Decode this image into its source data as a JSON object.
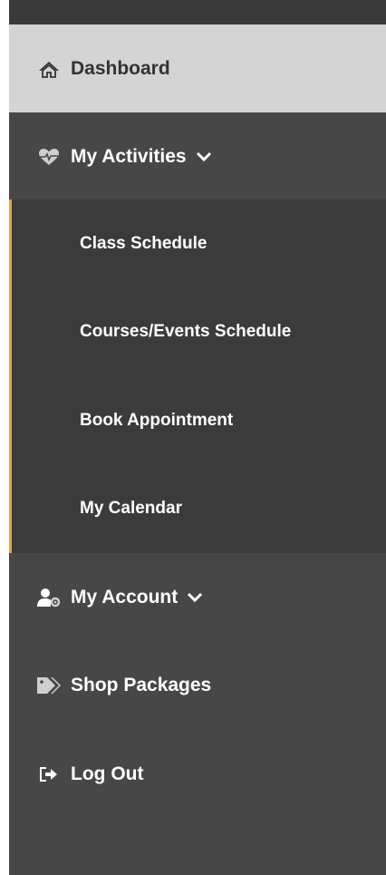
{
  "nav": {
    "dashboard": {
      "label": "Dashboard",
      "icon": "home-icon"
    },
    "activities": {
      "label": "My Activities",
      "icon": "heartbeat-icon",
      "submenu": [
        {
          "label": "Class Schedule"
        },
        {
          "label": "Courses/Events Schedule"
        },
        {
          "label": "Book Appointment"
        },
        {
          "label": "My Calendar"
        }
      ]
    },
    "account": {
      "label": "My Account",
      "icon": "user-cog-icon"
    },
    "shop": {
      "label": "Shop Packages",
      "icon": "tags-icon"
    },
    "logout": {
      "label": "Log Out",
      "icon": "sign-out-icon"
    }
  },
  "colors": {
    "sidebar_bg": "#474747",
    "submenu_bg": "#3b3b3b",
    "active_bg": "#d4d4d4",
    "accent": "#f0a030"
  }
}
